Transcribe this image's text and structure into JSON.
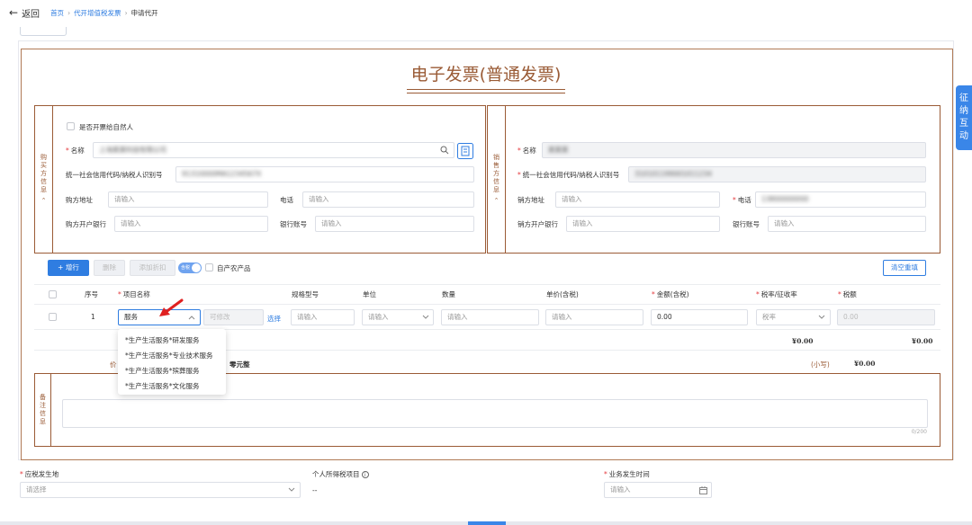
{
  "nav": {
    "back_arrow": "←",
    "back_label": "返回",
    "breadcrumb": [
      "首页",
      "代开增值税发票",
      "申请代开"
    ],
    "sep": "›"
  },
  "invoice": {
    "title": "电子发票(普通发票)"
  },
  "buyer": {
    "side_label": [
      "购",
      "买",
      "方",
      "信",
      "息"
    ],
    "natural_person_label": "是否开票给自然人",
    "name_label": "名称",
    "name_value": "上海某某科技有限公司",
    "tax_id_label": "统一社会信用代码/纳税人识别号",
    "tax_id_value": "91310000MA1234567X",
    "address_label": "购方地址",
    "address_placeholder": "请输入",
    "phone_label": "电话",
    "phone_placeholder": "请输入",
    "bank_label": "购方开户银行",
    "bank_placeholder": "请输入",
    "account_label": "银行账号",
    "account_placeholder": "请输入"
  },
  "seller": {
    "side_label": [
      "销",
      "售",
      "方",
      "信",
      "息"
    ],
    "name_label": "名称",
    "name_value": "某某某",
    "tax_id_label": "统一社会信用代码/纳税人识别号",
    "tax_id_value": "310101199001011234",
    "address_label": "销方地址",
    "address_placeholder": "请输入",
    "phone_label": "电话",
    "phone_value": "13800000000",
    "bank_label": "销方开户银行",
    "bank_placeholder": "请输入",
    "account_label": "银行账号",
    "account_placeholder": "请输入"
  },
  "toolbar": {
    "add_row": "+ 增行",
    "delete": "删除",
    "add_discount": "添加折扣",
    "toggle_label": "含税",
    "farm_label": "自产农产品",
    "clear": "清空重填"
  },
  "table": {
    "headers": [
      "序号",
      "项目名称",
      "规格型号",
      "单位",
      "数量",
      "单价(含税)",
      "金额(含税)",
      "税率/征收率",
      "税额"
    ],
    "row": {
      "index": "1",
      "item_name": "服务",
      "modifiable": "可修改",
      "select_link": "选择",
      "spec_placeholder": "请输入",
      "unit_placeholder": "请输入",
      "qty_placeholder": "请输入",
      "price_placeholder": "请输入",
      "amount": "0.00",
      "rate_placeholder": "税率",
      "tax": "0.00"
    },
    "total_amount": "¥0.00",
    "total_tax": "¥0.00",
    "total_label_prefix": "价",
    "total_upper": "零元整",
    "lower_label": "(小写)",
    "lower_value": "¥0.00"
  },
  "dropdown": {
    "options": [
      "*生产生活服务*研发服务",
      "*生产生活服务*专业技术服务",
      "*生产生活服务*殡葬服务",
      "*生产生活服务*文化服务"
    ]
  },
  "remark": {
    "side_label": [
      "备",
      "注",
      "信",
      "息"
    ],
    "counter": "0/200"
  },
  "footer": {
    "place_label": "应税发生地",
    "place_placeholder": "请选择",
    "income_label": "个人所得税项目",
    "income_value": "--",
    "time_label": "业务发生时间",
    "time_placeholder": "请输入"
  },
  "side_tab": {
    "chars": [
      "征",
      "纳",
      "互",
      "动"
    ]
  },
  "colors": {
    "primary": "#2f7de1",
    "invoice_brown": "#9a5b36",
    "required_red": "#e4393c"
  }
}
